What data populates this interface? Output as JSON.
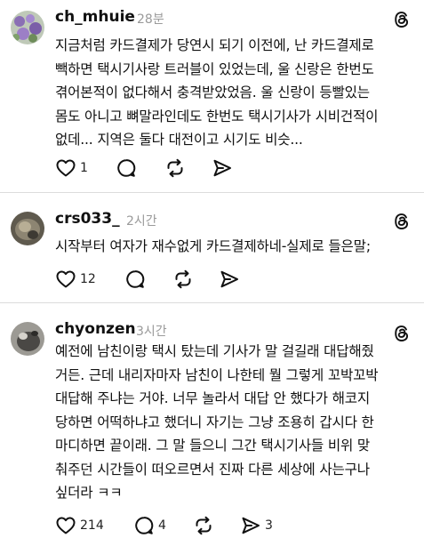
{
  "posts": [
    {
      "username": "ch_mhuie",
      "time": "28분",
      "lines": [
        "지금처럼 카드결제가 당연시 되기 이전에, 난 카드결제로",
        "빽하면 택시기사랑 트러블이 있었는데, 울 신랑은 한번도",
        "겪어본적이 없다해서 충격받았었음. 울 신랑이 등빨있는",
        "몸도 아니고 뼈말라인데도 한번도 택시기사가 시비건적이",
        "없데... 지역은 둘다 대전이고 시기도 비슷..."
      ],
      "likes": "1",
      "replies": "",
      "reposts": "",
      "shares": ""
    },
    {
      "username": "crs033_",
      "time": "2시간",
      "lines": [
        "시작부터 여자가 재수없게 카드결제하네-실제로 들은말;"
      ],
      "likes": "12",
      "replies": "",
      "reposts": "",
      "shares": ""
    },
    {
      "username": "chyonzen",
      "time": "3시간",
      "lines": [
        "예전에 남친이랑 택시 탔는데 기사가 말 걸길래 대답해줬",
        "거든. 근데 내리자마자 남친이 나한테 뭘 그렇게 꼬박꼬박",
        "대답해 주냐는 거야. 너무 놀라서 대답 안 했다가 해코지",
        "당하면 어떡하냐고 했더니 자기는 그냥 조용히 갑시다 한",
        "마디하면 끝이래. 그 말 들으니 그간 택시기사들 비위 맞",
        "춰주던 시간들이 떠오르면서 진짜 다른 세상에 사는구나",
        "싶더라 ㅋㅋ"
      ],
      "likes": "214",
      "replies": "4",
      "reposts": "",
      "shares": "3"
    }
  ]
}
